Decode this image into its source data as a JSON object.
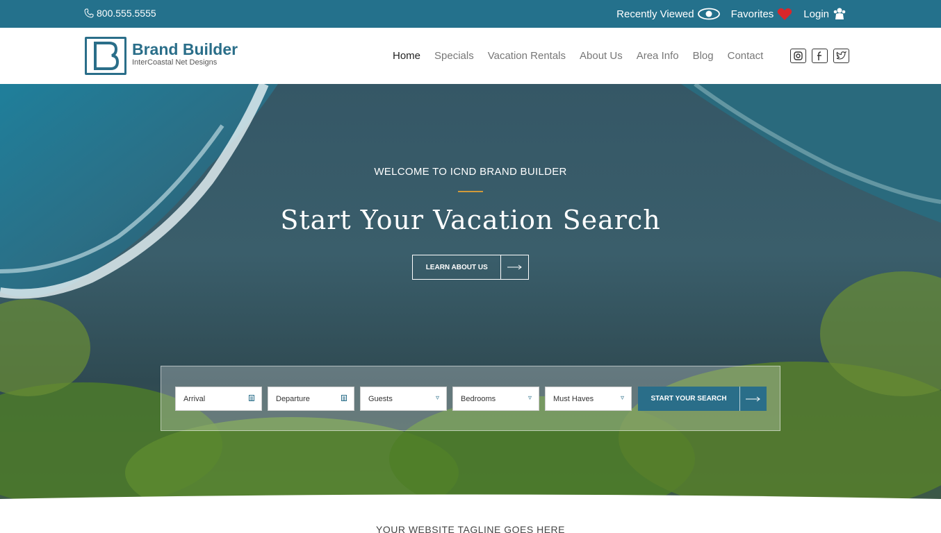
{
  "topbar": {
    "phone": "800.555.5555",
    "recently_viewed": "Recently Viewed",
    "favorites": "Favorites",
    "login": "Login"
  },
  "brand": {
    "name": "Brand Builder",
    "subtitle": "InterCoastal Net Designs"
  },
  "nav": {
    "items": [
      "Home",
      "Specials",
      "Vacation Rentals",
      "About Us",
      "Area Info",
      "Blog",
      "Contact"
    ]
  },
  "social": [
    "instagram-icon",
    "facebook-icon",
    "twitter-icon"
  ],
  "hero": {
    "welcome": "WELCOME TO ICND BRAND BUILDER",
    "headline": "Start Your Vacation Search",
    "learn_button": "LEARN ABOUT US"
  },
  "search": {
    "arrival": "Arrival",
    "departure": "Departure",
    "guests": "Guests",
    "bedrooms": "Bedrooms",
    "must_haves": "Must Haves",
    "start_button": "START YOUR SEARCH"
  },
  "tagline": "YOUR WEBSITE TAGLINE GOES HERE",
  "colors": {
    "brand": "#2a6e89",
    "topbar": "#24718c",
    "accent": "#d29a3a",
    "heart": "#d9262b"
  }
}
